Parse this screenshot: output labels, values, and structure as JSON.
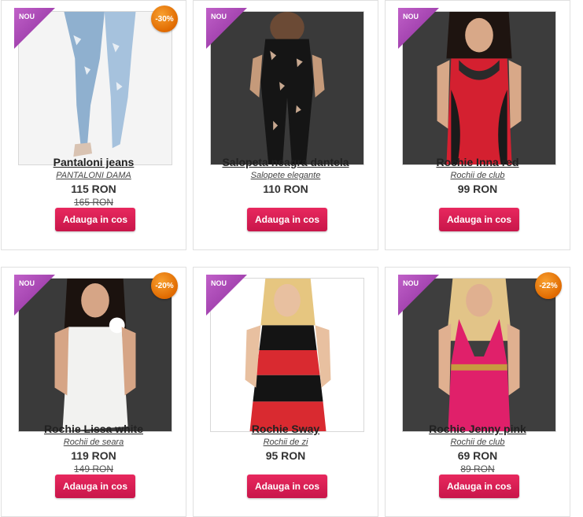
{
  "badge_new": "NOU",
  "add_to_cart_label": "Adauga in cos",
  "accent_color": "#d81f55",
  "products": [
    {
      "title": "Pantaloni jeans",
      "category": "PANTALONI DAMA",
      "price": "115 RON",
      "old_price": "165 RON",
      "discount": "-30%"
    },
    {
      "title": "Salopeta neagra dantela",
      "category": "Salopete elegante",
      "price": "110 RON"
    },
    {
      "title": "Rochie Inna red",
      "category": "Rochii de club",
      "price": "99 RON"
    },
    {
      "title": "Rochie Lissa white",
      "category": "Rochii de seara",
      "price": "119 RON",
      "old_price": "149 RON",
      "discount": "-20%"
    },
    {
      "title": "Rochie Sway",
      "category": "Rochii de zi",
      "price": "95 RON"
    },
    {
      "title": "Rochie Jenny pink",
      "category": "Rochii de club",
      "price": "69 RON",
      "old_price": "89 RON",
      "discount": "-22%"
    }
  ]
}
